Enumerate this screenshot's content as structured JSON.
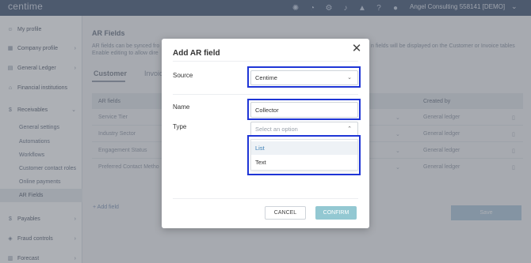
{
  "app": {
    "logo": "centime"
  },
  "topbar": {
    "icons": [
      "gear-icon",
      "chat-icon",
      "settings-icon",
      "bell-icon",
      "graduation-icon",
      "help-icon",
      "user-icon"
    ],
    "company": "Angel Consulting 558141 [DEMO]"
  },
  "sidebar": {
    "items": [
      {
        "label": "My profile",
        "icon": "user-icon"
      },
      {
        "label": "Company profile",
        "icon": "building-icon"
      },
      {
        "label": "General Ledger",
        "icon": "book-icon"
      },
      {
        "label": "Financial institutions",
        "icon": "bank-icon"
      },
      {
        "label": "Receivables",
        "icon": "dollar-icon"
      },
      {
        "label": "Payables",
        "icon": "dollar-icon"
      },
      {
        "label": "Fraud controls",
        "icon": "shield-icon"
      },
      {
        "label": "Forecast",
        "icon": "chart-icon"
      }
    ],
    "subitems": [
      "General settings",
      "Automations",
      "Workflows",
      "Customer contact roles",
      "Online payments",
      "AR Fields"
    ]
  },
  "main": {
    "title": "AR Fields",
    "desc_line1": "AR fields can be synced fro",
    "desc_line2": "Enable editing to allow dire",
    "desc_right": "n fields will be displayed on the Customer or Invoice tables",
    "tabs": [
      "Customer",
      "Invoic"
    ],
    "table": {
      "headers": [
        "AR fields",
        "Created by"
      ],
      "rows": [
        {
          "label": "Service Tier",
          "created": "General ledger"
        },
        {
          "label": "Industry Sector",
          "created": "General ledger"
        },
        {
          "label": "Engagement Status",
          "created": "General ledger"
        },
        {
          "label": "Preferred Contact Metho",
          "created": "General ledger"
        }
      ]
    },
    "add_field": "+ Add field",
    "save": "Save"
  },
  "modal": {
    "title": "Add AR field",
    "source_label": "Source",
    "source_value": "Centime",
    "name_label": "Name",
    "name_value": "Collector",
    "type_label": "Type",
    "type_placeholder": "Select an option",
    "options": [
      "List",
      "Text"
    ],
    "cancel": "CANCEL",
    "confirm": "CONFIRM"
  },
  "colors": {
    "highlight": "#1f35d6",
    "confirm": "#93c8d2",
    "topbar": "#5a6b86"
  }
}
